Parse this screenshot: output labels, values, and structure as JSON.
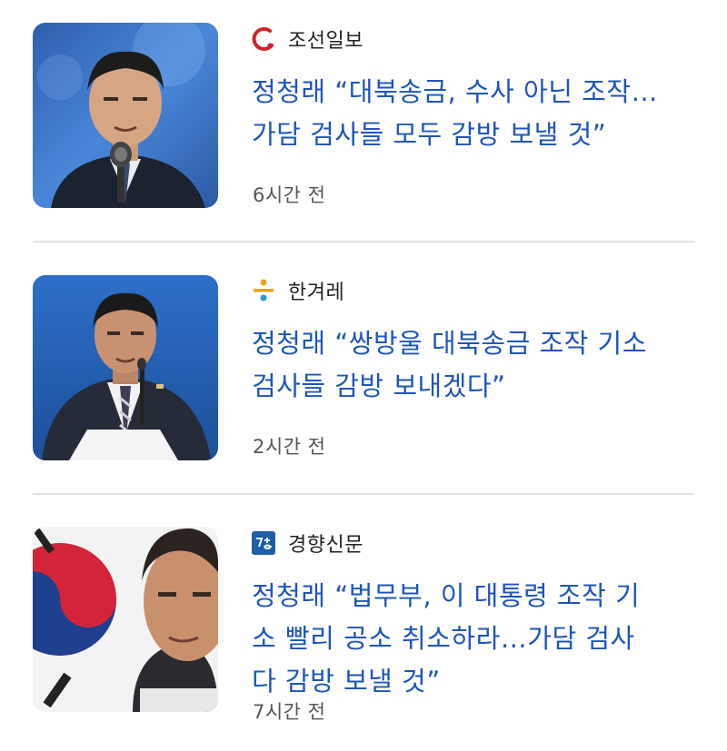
{
  "articles": [
    {
      "source": "조선일보",
      "source_logo": "chosun-logo",
      "headline_lines": [
        "정청래 “대북송금, 수사 아닌 조작…",
        "가담 검사들 모두 감방 보낼 것”"
      ],
      "time": "6시간 전"
    },
    {
      "source": "한겨레",
      "source_logo": "hankyoreh-logo",
      "headline_lines": [
        "정청래 “쌍방울 대북송금 조작 기소",
        "검사들 감방 보내겠다”"
      ],
      "time": "2시간 전"
    },
    {
      "source": "경향신문",
      "source_logo": "kyunghyang-logo",
      "headline_lines": [
        "정청래 “법무부, 이 대통령 조작 기",
        "소 빨리 공소 취소하라…가담 검사",
        "다 감방 보낼 것”"
      ],
      "time": "7시간 전"
    }
  ],
  "colors": {
    "headline": "#1f55b8",
    "divider": "#e2e2e2"
  }
}
